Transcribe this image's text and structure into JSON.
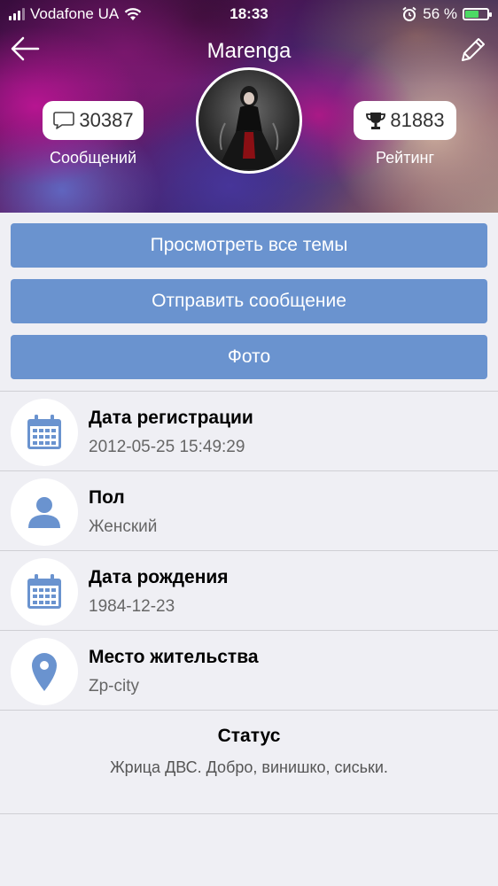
{
  "status_bar": {
    "carrier": "Vodafone UA",
    "time": "18:33",
    "battery_percent": "56 %",
    "battery_level": 0.56
  },
  "profile": {
    "username": "Marenga",
    "messages_count": "30387",
    "messages_label": "Сообщений",
    "rating_count": "81883",
    "rating_label": "Рейтинг"
  },
  "actions": {
    "view_topics": "Просмотреть все темы",
    "send_message": "Отправить сообщение",
    "photo": "Фото"
  },
  "info": [
    {
      "title": "Дата регистрации",
      "value": "2012-05-25 15:49:29",
      "icon": "calendar-icon"
    },
    {
      "title": "Пол",
      "value": "Женский",
      "icon": "person-icon"
    },
    {
      "title": "Дата рождения",
      "value": "1984-12-23",
      "icon": "calendar-icon"
    },
    {
      "title": "Место жительства",
      "value": "Zp-city",
      "icon": "location-pin-icon"
    }
  ],
  "status": {
    "title": "Статус",
    "text": "Жрица ДВС. Добро, винишко, сиськи."
  },
  "colors": {
    "button": "#6a93cf",
    "icon": "#6a93cf",
    "background": "#efeff4"
  }
}
